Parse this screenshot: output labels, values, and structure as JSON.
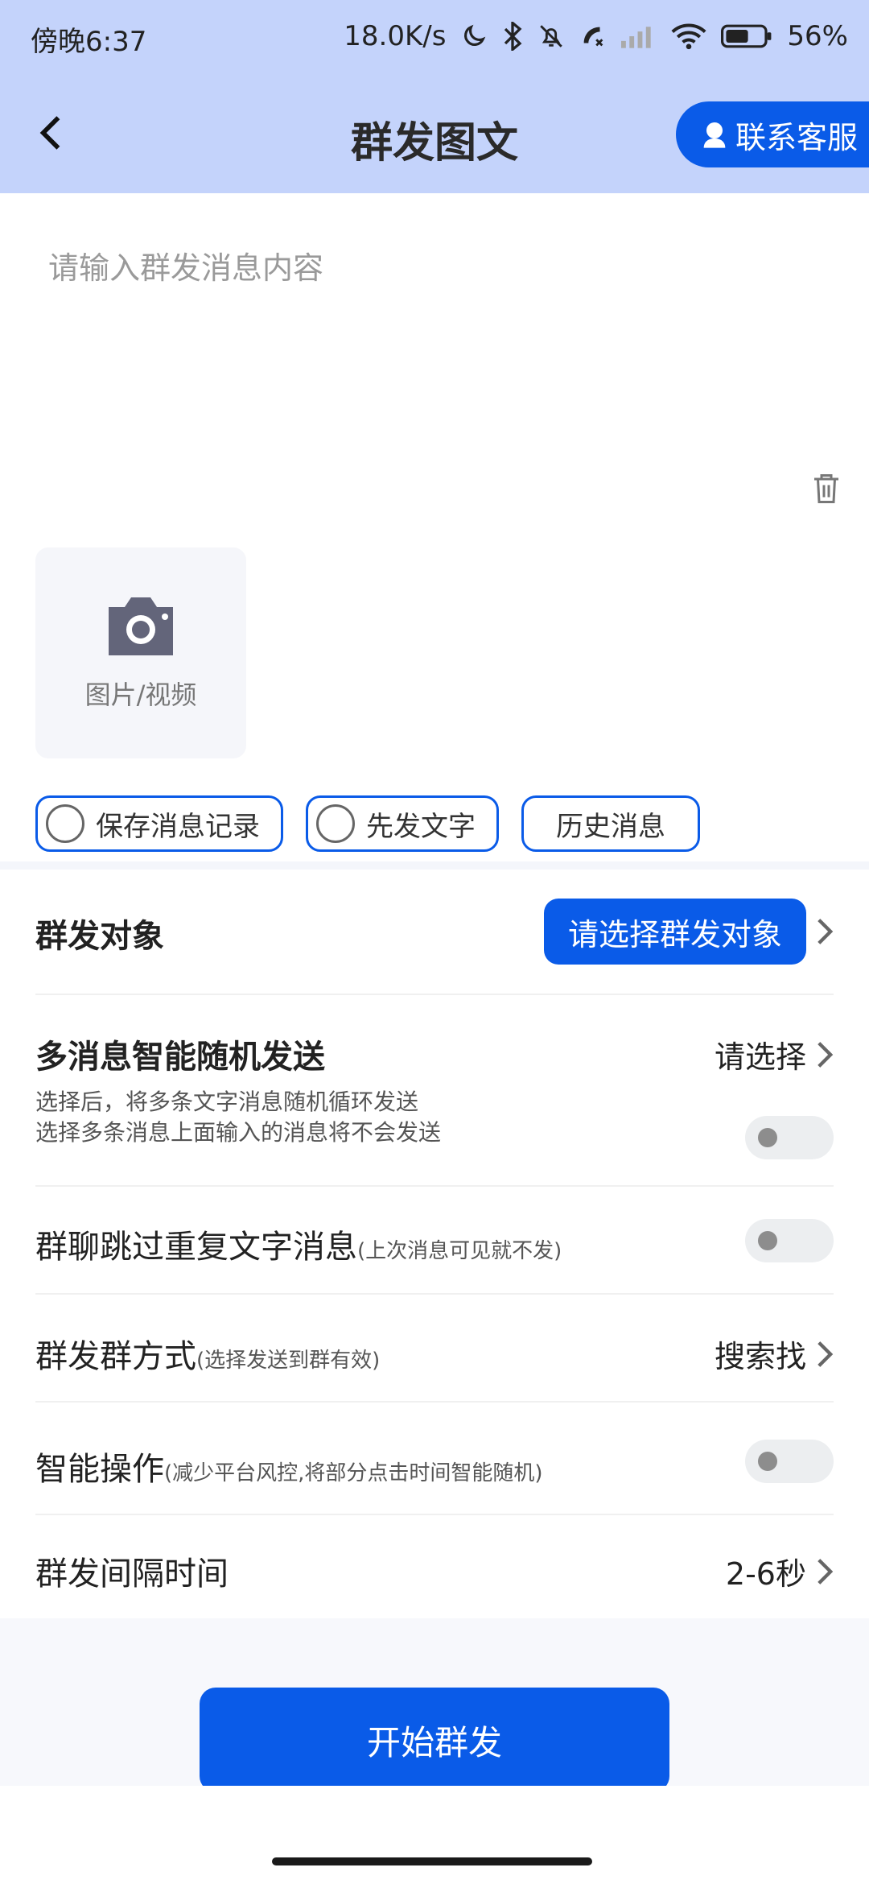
{
  "status_bar": {
    "time": "傍晚6:37",
    "network_speed": "18.0K/s",
    "battery_percent": "56%",
    "icons": [
      "moon-icon",
      "bluetooth-icon",
      "bell-off-icon",
      "call-icon",
      "signal-icon",
      "wifi-icon",
      "battery-icon"
    ]
  },
  "header": {
    "title": "群发图文",
    "contact_label": "联系客服"
  },
  "message": {
    "placeholder": "请输入群发消息内容",
    "value": ""
  },
  "media": {
    "label": "图片/视频"
  },
  "options": {
    "save_record": "保存消息记录",
    "text_first": "先发文字",
    "history": "历史消息"
  },
  "settings": {
    "target": {
      "label": "群发对象",
      "button": "请选择群发对象"
    },
    "multi_random": {
      "label": "多消息智能随机发送",
      "value": "请选择",
      "desc_line1": "选择后，将多条文字消息随机循环发送",
      "desc_line2": "选择多条消息上面输入的消息将不会发送",
      "enabled": false
    },
    "skip_repeat": {
      "label": "群聊跳过重复文字消息",
      "note": "(上次消息可见就不发)",
      "enabled": false
    },
    "group_method": {
      "label": "群发群方式",
      "note": "(选择发送到群有效)",
      "value": "搜索找"
    },
    "smart_op": {
      "label": "智能操作",
      "note": "(减少平台风控,将部分点击时间智能随机)",
      "enabled": false
    },
    "interval": {
      "label": "群发间隔时间",
      "value": "2-6秒"
    }
  },
  "footer": {
    "start_label": "开始群发"
  },
  "colors": {
    "header_bg": "#c4d3fb",
    "accent": "#0a5be8",
    "toggle_off": "#eceef0"
  }
}
